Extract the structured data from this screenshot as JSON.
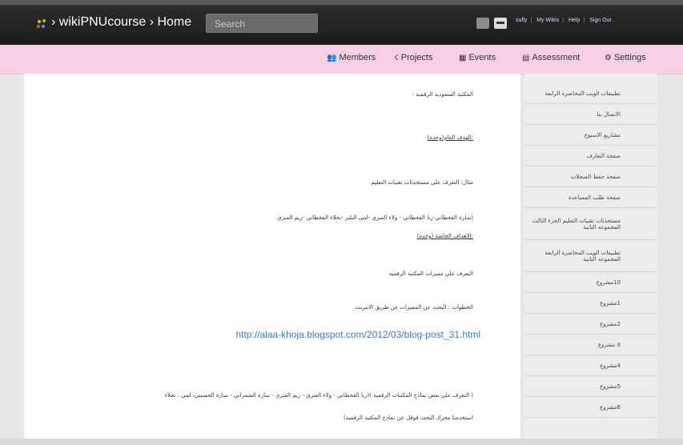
{
  "header": {
    "breadcrumb": "› wikiPNUcourse › Home",
    "search_placeholder": "Search",
    "user_links": [
      "sufly",
      "My Wikis",
      "Help",
      "Sign Out"
    ]
  },
  "nav": {
    "items": [
      {
        "label": "Members",
        "icon": "users-icon"
      },
      {
        "label": "Projects",
        "icon": "projects-icon"
      },
      {
        "label": "Events",
        "icon": "calendar-icon"
      },
      {
        "label": "Assessment",
        "icon": "chart-icon"
      },
      {
        "label": "Settings",
        "icon": "gear-icon"
      }
    ]
  },
  "sidebar": {
    "items": [
      "تطبيقات الويب المحاضرة الرابعة",
      "الاتصال بنا",
      "مشاريع الاسبوع",
      "صفحة التعارف",
      "صفحة حفظ السجلات",
      "صفحة طلب المساعدة",
      "مستحدثات تقنيات التعليم الجزء الثالث المجموعة الثانية",
      "تطبيقات الويب المحاضرة الرابعة المجموعة الثانية",
      "10مشروع",
      "1مشروع",
      "2مشروع",
      "3 مشروع",
      "4مشروع",
      "5مشروع",
      "6مشروع"
    ]
  },
  "content": {
    "p1": "المكتبة السعودية الرقمية -",
    "h1": ":الهدف العام(وحدة)",
    "p2": "مثال: التعرف على مستحدثات تقنيات التعليم",
    "p3": "(سارة القحطاني-رنا القحطاني - ولاء العنزي -لمى البلير -نجلاء القحطاني -ريم العنزي",
    "h2": ":الاهداف الخاصة (وحدة)",
    "p4": "التعرف على مميزات المكتبة الرقمية",
    "p5": "الخطوات : البحث عن المميزات عن طريق الانترنت",
    "link": "http://alaa-khoja.blogspot.com/2012/03/blog-post_31.html",
    "p6": "( التعرف على بعض نماذج المكتبات الرقمية )(رنا القحطاني - ولاء العنزي - ريم العنزي - سارة الشمراني - سارة الحسيني، لمى ، نجلاء",
    "p7": "استخدمنا محرك البحث قوقل عن نماذج المكتبة الرقمية)"
  }
}
